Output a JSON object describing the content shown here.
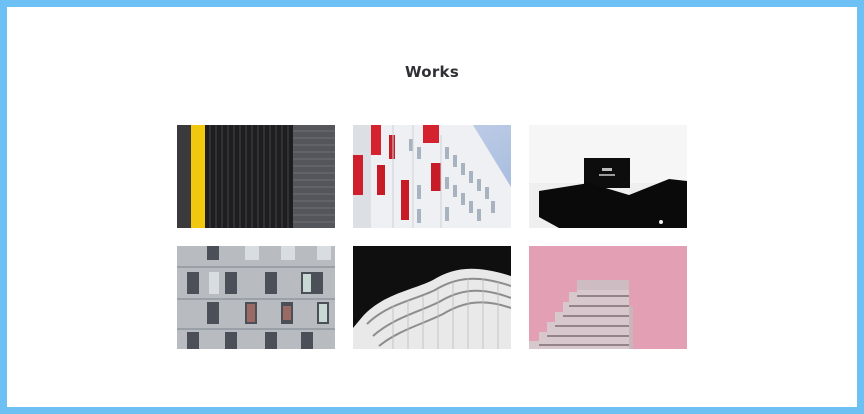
{
  "section": {
    "title": "Works"
  },
  "colors": {
    "frame": "#6cc0f4",
    "title": "#2f2f35",
    "background": "#ffffff"
  },
  "works": [
    {
      "name": "dark-facade-yellow-stripe-photo"
    },
    {
      "name": "white-building-red-panels-photo"
    },
    {
      "name": "white-wall-black-sign-photo"
    },
    {
      "name": "grey-facade-windows-photo"
    },
    {
      "name": "white-curved-balconies-photo"
    },
    {
      "name": "pink-sky-stepped-building-photo"
    }
  ]
}
